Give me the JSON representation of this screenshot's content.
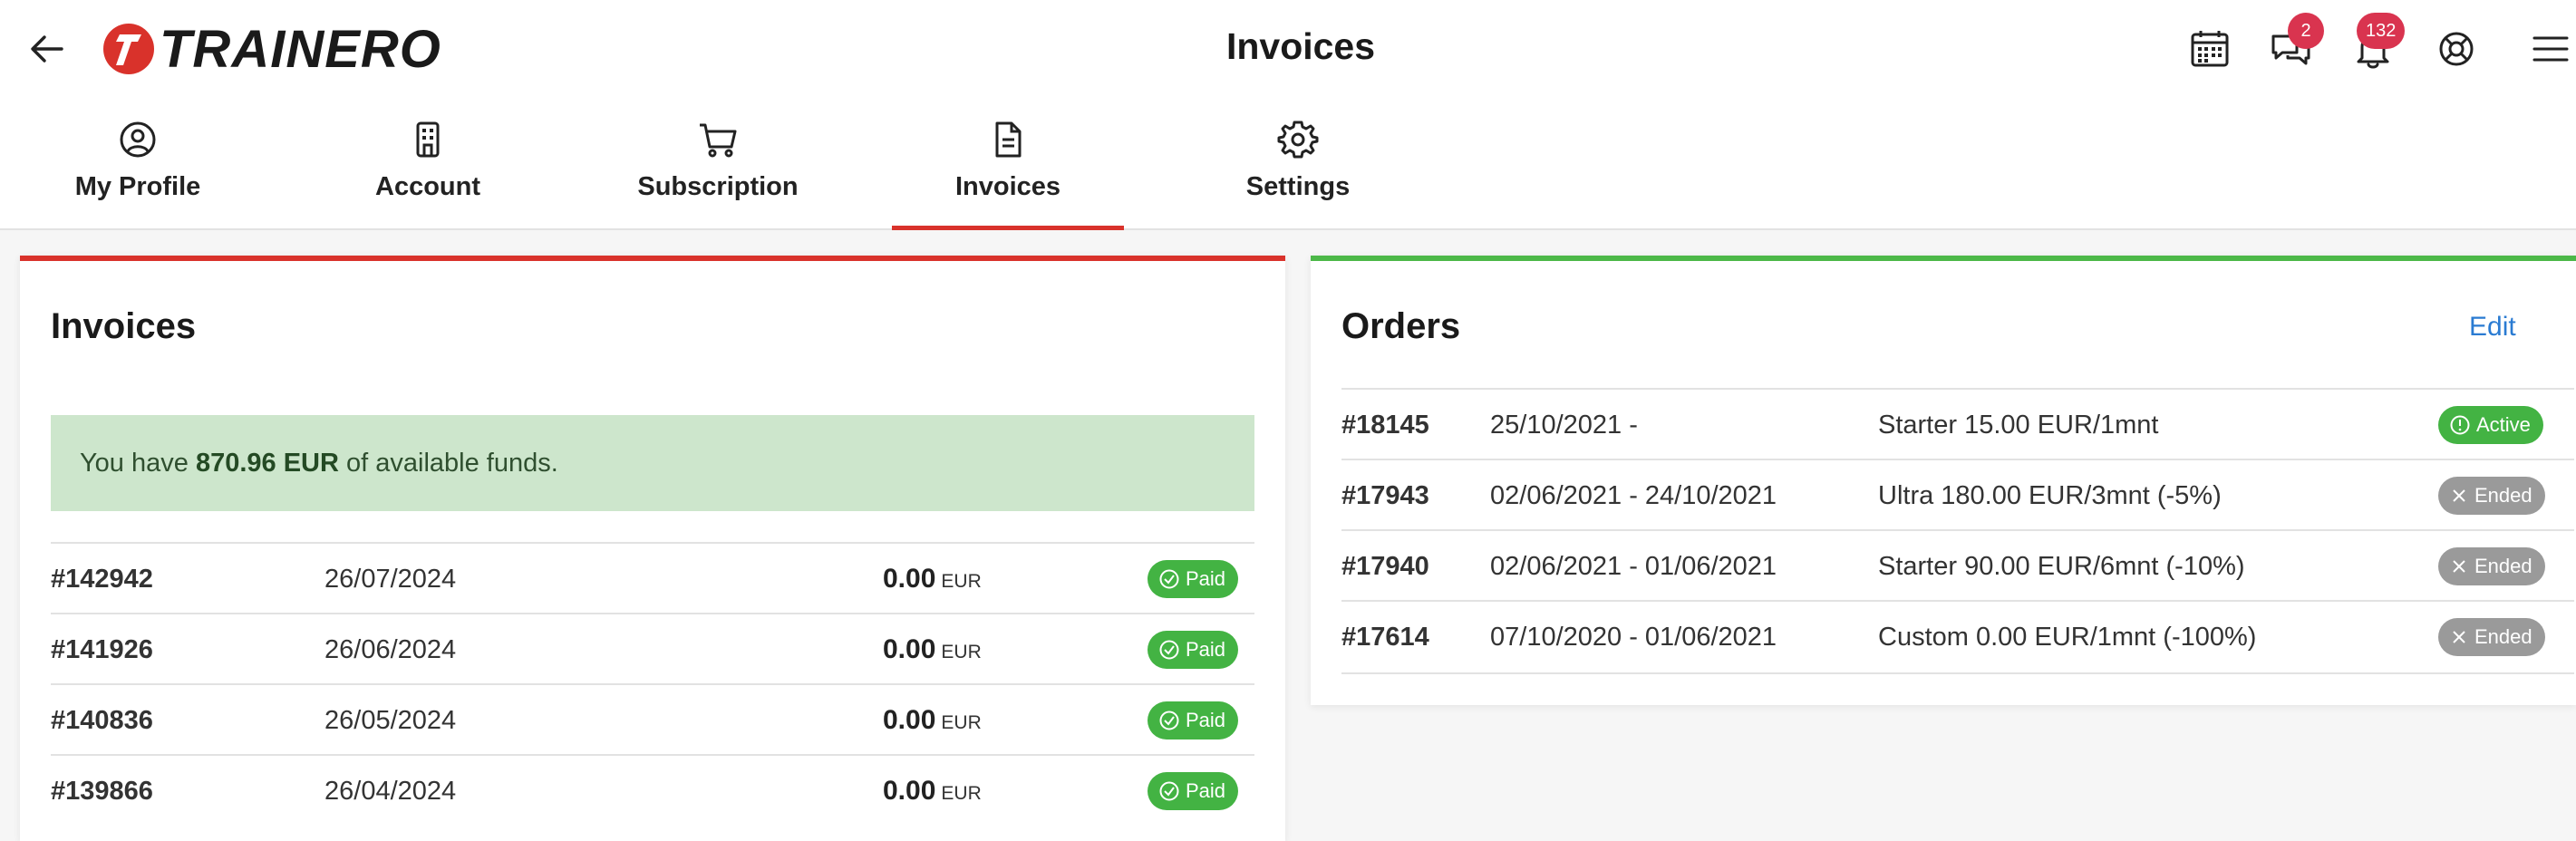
{
  "header": {
    "brand": "TRAINERO",
    "title": "Invoices",
    "messages_badge": "2",
    "notifications_badge": "132",
    "icons": [
      "back-arrow-icon",
      "calendar-icon",
      "chat-icon",
      "bell-icon",
      "help-icon",
      "menu-icon"
    ]
  },
  "tabs": [
    {
      "label": "My Profile",
      "icon": "user-circle-icon"
    },
    {
      "label": "Account",
      "icon": "building-icon"
    },
    {
      "label": "Subscription",
      "icon": "cart-icon"
    },
    {
      "label": "Invoices",
      "icon": "document-icon",
      "active": true
    },
    {
      "label": "Settings",
      "icon": "gear-icon"
    }
  ],
  "invoices": {
    "title": "Invoices",
    "funds_prefix": "You have",
    "funds_amount": "870.96 EUR",
    "funds_suffix": "of available funds.",
    "rows": [
      {
        "id": "#142942",
        "date": "26/07/2024",
        "amount": "0.00",
        "currency": "EUR",
        "status": "Paid"
      },
      {
        "id": "#141926",
        "date": "26/06/2024",
        "amount": "0.00",
        "currency": "EUR",
        "status": "Paid"
      },
      {
        "id": "#140836",
        "date": "26/05/2024",
        "amount": "0.00",
        "currency": "EUR",
        "status": "Paid"
      },
      {
        "id": "#139866",
        "date": "26/04/2024",
        "amount": "0.00",
        "currency": "EUR",
        "status": "Paid"
      }
    ]
  },
  "orders": {
    "title": "Orders",
    "edit_label": "Edit",
    "rows": [
      {
        "id": "#18145",
        "period": "25/10/2021 -",
        "plan": "Starter 15.00 EUR/1mnt",
        "status": "Active"
      },
      {
        "id": "#17943",
        "period": "02/06/2021 - 24/10/2021",
        "plan": "Ultra 180.00 EUR/3mnt (-5%)",
        "status": "Ended"
      },
      {
        "id": "#17940",
        "period": "02/06/2021 - 01/06/2021",
        "plan": "Starter 90.00 EUR/6mnt (-10%)",
        "status": "Ended"
      },
      {
        "id": "#17614",
        "period": "07/10/2020 - 01/06/2021",
        "plan": "Custom 0.00 EUR/1mnt (-100%)",
        "status": "Ended"
      }
    ]
  },
  "colors": {
    "brand_red": "#d9322b",
    "paid_green": "#43b343",
    "ended_gray": "#9a9a9a",
    "funds_bg": "#cde6cc",
    "orders_accent": "#4cb848",
    "link_blue": "#2a7bd2",
    "badge_red": "#d9344f"
  }
}
